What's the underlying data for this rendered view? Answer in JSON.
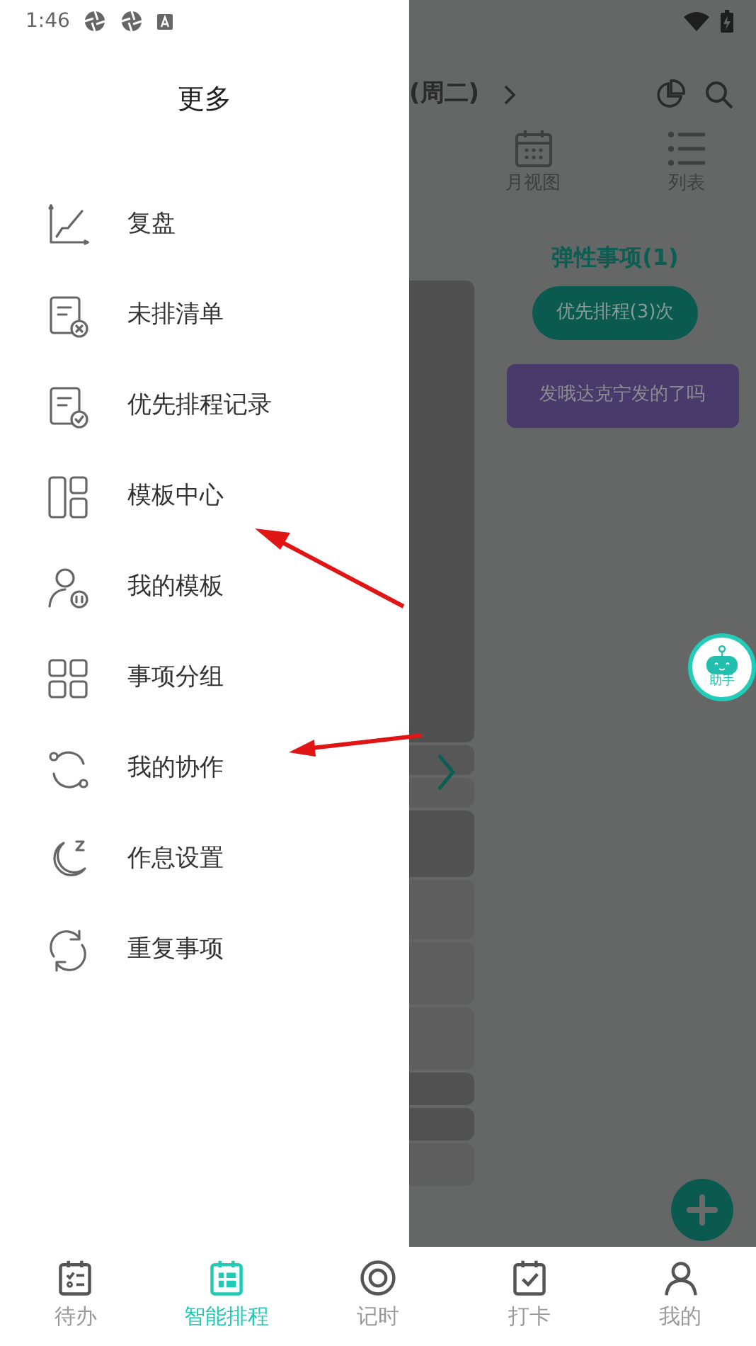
{
  "status_bar": {
    "time": "1:46"
  },
  "drawer": {
    "title": "更多",
    "items": [
      {
        "label": "复盘"
      },
      {
        "label": "未排清单"
      },
      {
        "label": "优先排程记录"
      },
      {
        "label": "模板中心"
      },
      {
        "label": "我的模板"
      },
      {
        "label": "事项分组"
      },
      {
        "label": "我的协作"
      },
      {
        "label": "作息设置"
      },
      {
        "label": "重复事项"
      }
    ]
  },
  "background": {
    "date_suffix": "(周二)",
    "view_tabs": [
      {
        "label": "月视图"
      },
      {
        "label": "列表"
      }
    ],
    "section_title": "弹性事项(1)",
    "priority_button": "优先排程(3)次",
    "task_card": {
      "text": "发哦达克宁发的了吗",
      "color": "#483a6a"
    },
    "assistant": {
      "label": "助手"
    }
  },
  "bottom_nav": [
    {
      "label": "待办",
      "selected": false
    },
    {
      "label": "智能排程",
      "selected": true
    },
    {
      "label": "记时",
      "selected": false
    },
    {
      "label": "打卡",
      "selected": false
    },
    {
      "label": "我的",
      "selected": false
    }
  ]
}
